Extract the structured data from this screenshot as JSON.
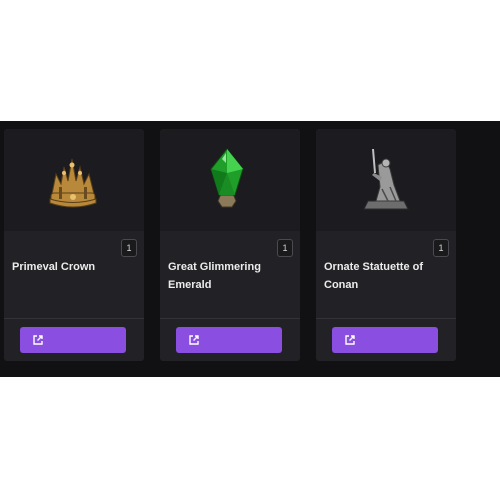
{
  "items": [
    {
      "name": "Primeval Crown",
      "quantity": "1",
      "button_icon": "external-link-icon",
      "image": "crown-icon"
    },
    {
      "name": "Great Glimmering Emerald",
      "quantity": "1",
      "button_icon": "external-link-icon",
      "image": "emerald-icon"
    },
    {
      "name": "Ornate Statuette of Conan",
      "quantity": "1",
      "button_icon": "external-link-icon",
      "image": "statuette-icon"
    }
  ],
  "colors": {
    "strip_background": "#111113",
    "card_background": "#222226",
    "button_accent": "#8a4fe0"
  }
}
